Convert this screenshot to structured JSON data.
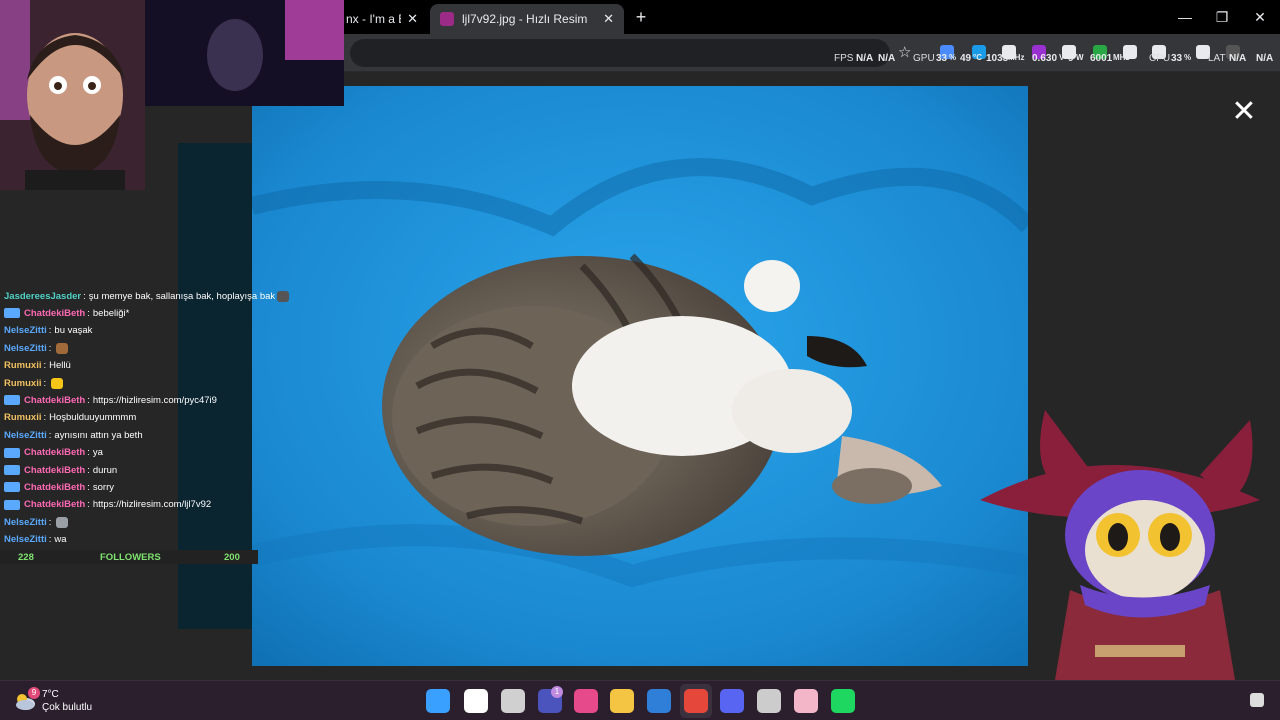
{
  "browser": {
    "tabs": [
      {
        "title": "nx - I'm a Bi",
        "active": false
      },
      {
        "title": "ljl7v92.jpg - Hızlı Resim",
        "active": true
      }
    ],
    "new_tab_label": "+",
    "close_glyph": "✕",
    "window": {
      "minimize": "—",
      "maximize": "❐",
      "close": "✕"
    }
  },
  "hud": {
    "fps_label": "FPS",
    "fps_value1": "N/A",
    "fps_value2": "N/A",
    "gpu_label": "GPU",
    "gpu_usage": "33",
    "gpu_unit": "%",
    "gpu_temp": "49",
    "gpu_temp_unit": "°C",
    "gpu_clock": "1035",
    "gpu_clock_unit": "MHz",
    "voltage": "0.630",
    "voltage_unit": "V",
    "power": "9",
    "power_unit": "W",
    "mem_clock": "6001",
    "mem_clock_unit": "MHz",
    "cpu_label": "CPU",
    "cpu_usage": "33",
    "cpu_unit": "%",
    "lat_label": "LAT",
    "lat_value1": "N/A",
    "lat_value2": "N/A"
  },
  "lightbox": {
    "close_glyph": "✕"
  },
  "chat": {
    "messages": [
      {
        "user": "JasdereesJasder",
        "user_color": "#4fd1c5",
        "badge": false,
        "text": "şu memye bak, sallanışa bak, hoplayışa bak",
        "emote_color": "#555555"
      },
      {
        "user": "ChatdekiBeth",
        "user_color": "#ff69b4",
        "badge": true,
        "text": "bebeliği*"
      },
      {
        "user": "NelseZitti",
        "user_color": "#5aa9ff",
        "badge": false,
        "text": "bu vaşak"
      },
      {
        "user": "NelseZitti",
        "user_color": "#5aa9ff",
        "badge": false,
        "text": "",
        "emote_color": "#a06a3a"
      },
      {
        "user": "Rumuxii",
        "user_color": "#f0c060",
        "badge": false,
        "text": "Hellü"
      },
      {
        "user": "Rumuxii",
        "user_color": "#f0c060",
        "badge": false,
        "text": "",
        "emote_color": "#f5c518"
      },
      {
        "user": "ChatdekiBeth",
        "user_color": "#ff69b4",
        "badge": true,
        "text": "https://hizliresim.com/pyc47i9"
      },
      {
        "user": "Rumuxii",
        "user_color": "#f0c060",
        "badge": false,
        "text": "Hoşbulduuyummmm"
      },
      {
        "user": "NelseZitti",
        "user_color": "#5aa9ff",
        "badge": false,
        "text": "aynısını attın ya beth"
      },
      {
        "user": "ChatdekiBeth",
        "user_color": "#ff69b4",
        "badge": true,
        "text": "ya"
      },
      {
        "user": "ChatdekiBeth",
        "user_color": "#ff69b4",
        "badge": true,
        "text": "durun"
      },
      {
        "user": "ChatdekiBeth",
        "user_color": "#ff69b4",
        "badge": true,
        "text": "sorry"
      },
      {
        "user": "ChatdekiBeth",
        "user_color": "#ff69b4",
        "badge": true,
        "text": "https://hizliresim.com/ljl7v92"
      },
      {
        "user": "NelseZitti",
        "user_color": "#5aa9ff",
        "badge": false,
        "text": "",
        "emote_color": "#9aa0a6"
      },
      {
        "user": "NelseZitti",
        "user_color": "#5aa9ff",
        "badge": false,
        "text": "wa"
      }
    ],
    "separator": ":",
    "followers": {
      "left": "228",
      "label": "FOLLOWERS",
      "right": "200"
    }
  },
  "taskbar": {
    "weather_temp": "7°C",
    "weather_desc": "Çok bulutlu",
    "weather_badge": "9",
    "apps": [
      {
        "name": "windows-start-icon",
        "color": "#3aa0ff"
      },
      {
        "name": "search-icon",
        "color": "#ffffff"
      },
      {
        "name": "task-view-icon",
        "color": "#d0d0d0"
      },
      {
        "name": "teams-icon",
        "color": "#4b53bc"
      },
      {
        "name": "microsoft-365-icon",
        "color": "#e64a8a"
      },
      {
        "name": "file-explorer-icon",
        "color": "#f4c542"
      },
      {
        "name": "microsoft-store-icon",
        "color": "#2f7fd8"
      },
      {
        "name": "chrome-icon",
        "color": "#e5483b"
      },
      {
        "name": "discord-icon",
        "color": "#5865f2"
      },
      {
        "name": "obs-icon",
        "color": "#cccccc"
      },
      {
        "name": "photo-app-icon",
        "color": "#f3b6c8"
      },
      {
        "name": "spotify-icon",
        "color": "#1ed760"
      }
    ],
    "teams_badge": "1"
  }
}
